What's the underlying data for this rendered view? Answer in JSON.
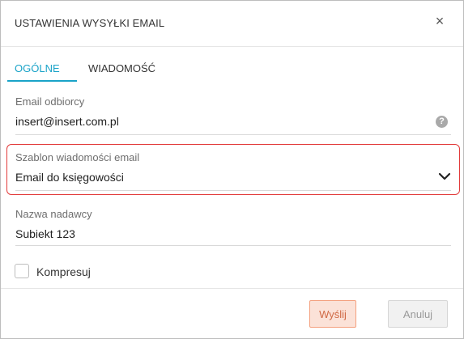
{
  "dialog": {
    "title": "USTAWIENIA WYSYŁKI EMAIL",
    "close_glyph": "×"
  },
  "tabs": [
    {
      "label": "OGÓLNE",
      "active": true
    },
    {
      "label": "WIADOMOŚĆ",
      "active": false
    }
  ],
  "fields": {
    "recipient": {
      "label": "Email odbiorcy",
      "value": "insert@insert.com.pl",
      "help_glyph": "?"
    },
    "template": {
      "label": "Szablon wiadomości email",
      "value": "Email do księgowości"
    },
    "sender": {
      "label": "Nazwa nadawcy",
      "value": "Subiekt 123"
    }
  },
  "compress": {
    "label": "Kompresuj",
    "checked": false
  },
  "buttons": {
    "send": "Wyślij",
    "cancel": "Anuluj"
  },
  "colors": {
    "accent": "#1aa3c8",
    "highlight": "#e23b3b",
    "send_bg": "#fbe2d8",
    "send_border": "#f4a07e"
  },
  "icons": {
    "close": "close-icon",
    "help": "question-circle-icon",
    "dropdown": "chevron-down-icon"
  }
}
